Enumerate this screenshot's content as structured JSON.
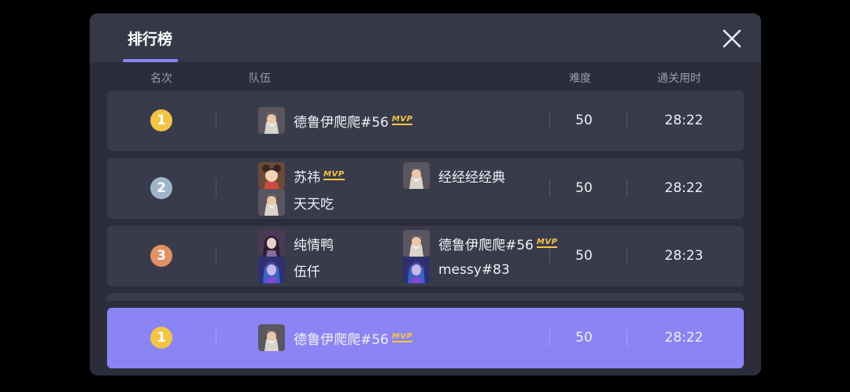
{
  "header": {
    "tab_label": "排行榜"
  },
  "columns": {
    "rank": "名次",
    "team": "队伍",
    "difficulty": "难度",
    "time": "通关用时"
  },
  "mvp_badge": "MVP",
  "colors": {
    "gold": "#f3c446",
    "silver": "#9fb6c9",
    "bronze": "#e19163",
    "accent": "#8b84f5"
  },
  "rows": [
    {
      "rank": "1",
      "medal": "gold",
      "members": [
        {
          "name": "德鲁伊爬爬#56",
          "avatar": "old-sage-avatar"
        }
      ],
      "mvp": "德鲁伊爬爬#56",
      "difficulty": "50",
      "time": "28:22"
    },
    {
      "rank": "2",
      "medal": "silver",
      "members": [
        {
          "name": "苏祎",
          "avatar": "panda-girl-avatar"
        },
        {
          "name": "经经经经典",
          "avatar": "old-sage-avatar"
        },
        {
          "name": "天天吃",
          "avatar": "old-sage-avatar"
        }
      ],
      "mvp": "苏祎",
      "difficulty": "50",
      "time": "28:22"
    },
    {
      "rank": "3",
      "medal": "bronze",
      "members": [
        {
          "name": "纯情鸭",
          "avatar": "dark-hair-woman-avatar"
        },
        {
          "name": "德鲁伊爬爬#56",
          "avatar": "old-sage-avatar"
        },
        {
          "name": "伍仟",
          "avatar": "blue-mage-avatar"
        },
        {
          "name": "messy#83",
          "avatar": "blue-mage-avatar"
        }
      ],
      "mvp": "德鲁伊爬爬#56",
      "difficulty": "50",
      "time": "28:23"
    }
  ],
  "my_row": {
    "rank": "1",
    "medal": "gold",
    "members": [
      {
        "name": "德鲁伊爬爬#56",
        "avatar": "old-sage-avatar"
      }
    ],
    "mvp": "德鲁伊爬爬#56",
    "difficulty": "50",
    "time": "28:22"
  }
}
